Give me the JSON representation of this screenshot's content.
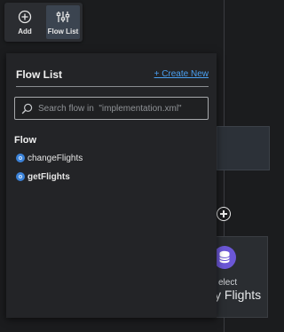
{
  "toolbar": {
    "add_label": "Add",
    "flowlist_label": "Flow List"
  },
  "panel": {
    "title": "Flow List",
    "create_link": "+ Create New",
    "search_placeholder": "Search flow in  \"implementation.xml\"",
    "section_label": "Flow",
    "flows": [
      {
        "name": "changeFlights",
        "bold": false
      },
      {
        "name": "getFlights",
        "bold": true
      }
    ]
  },
  "canvas": {
    "node_subtitle": "elect",
    "node_title": "y Flights"
  },
  "colors": {
    "accent_link": "#4a9ff0",
    "flow_dot": "#3b82d8",
    "node_icon": "#6b57d6"
  }
}
